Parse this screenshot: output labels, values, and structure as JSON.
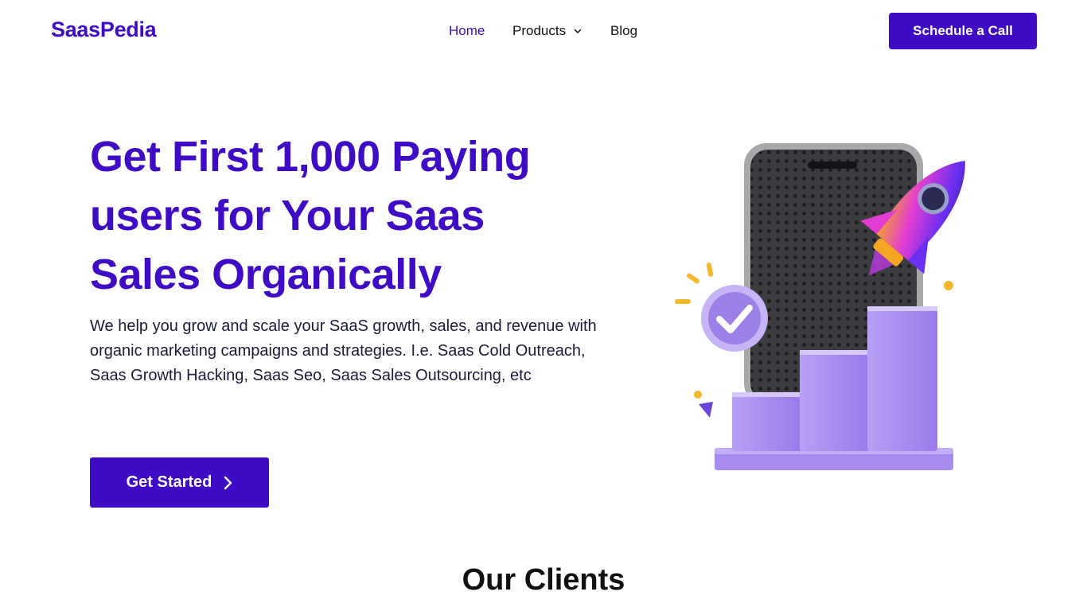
{
  "header": {
    "logo": "SaasPedia",
    "nav": [
      {
        "label": "Home",
        "active": true
      },
      {
        "label": "Products",
        "has_dropdown": true
      },
      {
        "label": "Blog"
      }
    ],
    "cta_label": "Schedule a Call"
  },
  "hero": {
    "title": "Get First 1,000 Paying users for Your Saas Sales Organically",
    "description": "We help you grow and scale your SaaS growth, sales, and revenue with organic marketing campaigns and strategies. I.e. Saas Cold Outreach, Saas Growth Hacking, Saas Seo, Saas Sales Outsourcing, etc",
    "cta_label": "Get Started"
  },
  "clients": {
    "title": "Our Clients"
  },
  "colors": {
    "brand": "#3f0bc4",
    "text_dark": "#111111",
    "illustration_purple": "#a98bf0"
  },
  "icons": [
    "chevron-down-icon",
    "chevron-right-icon",
    "check-icon",
    "rocket-icon",
    "phone-icon",
    "bar-chart-icon"
  ]
}
